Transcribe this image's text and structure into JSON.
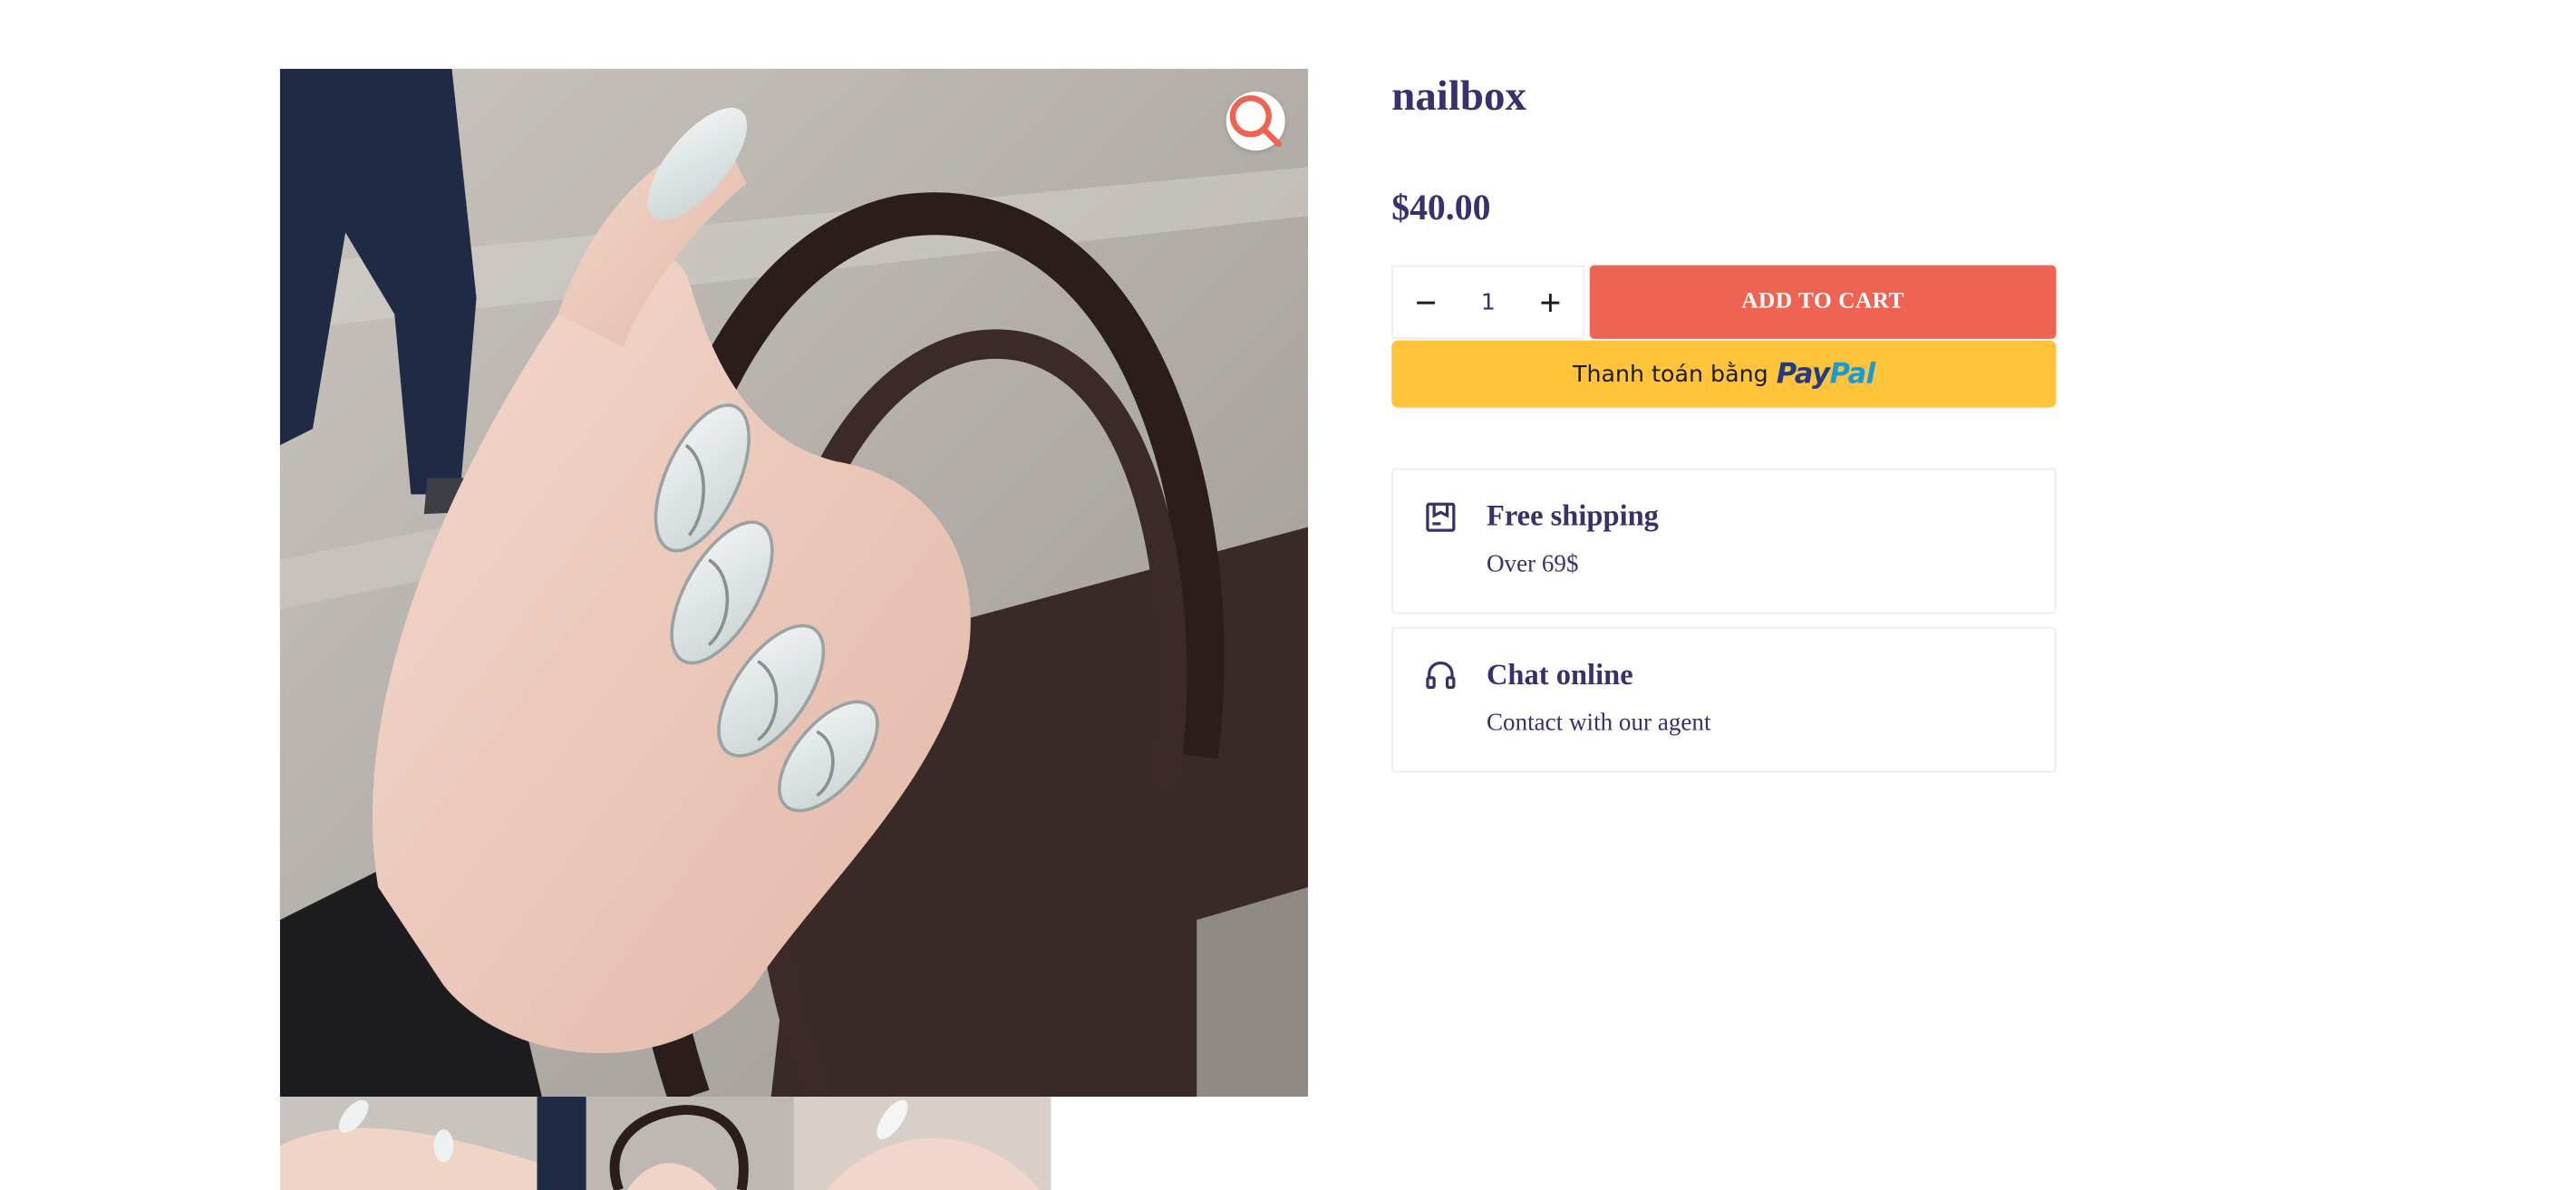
{
  "product": {
    "title": "nailbox",
    "price": "$40.00"
  },
  "gallery": {
    "zoom_icon": "search-icon",
    "thumbnail_count": 3
  },
  "cart": {
    "quantity": "1",
    "decrease_icon": "minus-icon",
    "increase_icon": "plus-icon",
    "add_to_cart_label": "ADD TO CART"
  },
  "paypal": {
    "label": "Thanh toán bằng",
    "logo_part1": "Pay",
    "logo_part2": "Pal"
  },
  "features": [
    {
      "icon": "shipping-box-icon",
      "title": "Free shipping",
      "subtitle": "Over 69$"
    },
    {
      "icon": "headset-icon",
      "title": "Chat online",
      "subtitle": "Contact with our agent"
    }
  ],
  "colors": {
    "text": "#3b2f6e",
    "add_to_cart": "#ee6352",
    "paypal": "#ffc439",
    "zoom_icon": "#ee6352"
  }
}
